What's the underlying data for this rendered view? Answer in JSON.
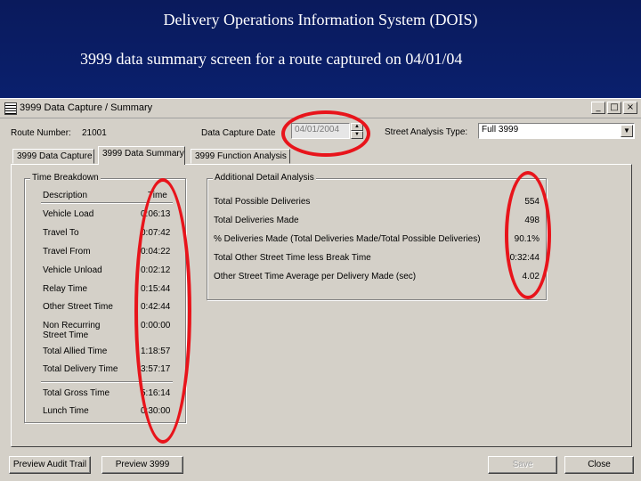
{
  "slide": {
    "title": "Delivery Operations Information System (DOIS)",
    "subtitle": "3999 data summary screen for a route captured on 04/01/04"
  },
  "window": {
    "title": "3999 Data Capture / Summary",
    "controls": [
      "_",
      "□",
      "×"
    ]
  },
  "form": {
    "route_number_label": "Route Number:",
    "route_number_value": "21001",
    "capture_date_label": "Data Capture Date",
    "capture_date_value": "04/01/2004",
    "street_analysis_label": "Street Analysis Type:",
    "street_analysis_value": "Full 3999"
  },
  "tabs": [
    {
      "label": "3999 Data Capture",
      "active": false
    },
    {
      "label": "3999 Data Summary",
      "active": true
    },
    {
      "label": "3999 Function Analysis",
      "active": false
    }
  ],
  "time_breakdown": {
    "title": "Time Breakdown",
    "col_description": "Description",
    "col_time": "Time",
    "rows": [
      {
        "desc": "Vehicle Load",
        "time": "0:06:13"
      },
      {
        "desc": "Travel To",
        "time": "0:07:42"
      },
      {
        "desc": "Travel From",
        "time": "0:04:22"
      },
      {
        "desc": "Vehicle Unload",
        "time": "0:02:12"
      },
      {
        "desc": "Relay Time",
        "time": "0:15:44"
      },
      {
        "desc": "Other Street Time",
        "time": "0:42:44"
      },
      {
        "desc": "Non Recurring Street Time",
        "time": "0:00:00"
      }
    ],
    "totals": [
      {
        "desc": "Total Allied Time",
        "time": "1:18:57"
      },
      {
        "desc": "Total Delivery Time",
        "time": "3:57:17"
      }
    ],
    "gross": [
      {
        "desc": "Total Gross Time",
        "time": "5:16:14"
      },
      {
        "desc": "Lunch Time",
        "time": "0:30:00"
      }
    ]
  },
  "additional_detail": {
    "title": "Additional Detail Analysis",
    "rows": [
      {
        "label": "Total Possible Deliveries",
        "value": "554"
      },
      {
        "label": "Total Deliveries Made",
        "value": "498"
      },
      {
        "label": "% Deliveries Made (Total Deliveries Made/Total Possible Deliveries)",
        "value": "90.1%"
      },
      {
        "label": "Total Other Street Time less Break Time",
        "value": "0:32:44"
      },
      {
        "label": "Other Street Time Average per Delivery Made (sec)",
        "value": "4.02"
      }
    ]
  },
  "buttons": {
    "preview_audit_trail": "Preview Audit Trail",
    "preview_3999": "Preview 3999",
    "save": "Save",
    "close": "Close"
  },
  "colors": {
    "annotation_circle": "#e8141b",
    "slide_background": "#0b2a8a"
  }
}
